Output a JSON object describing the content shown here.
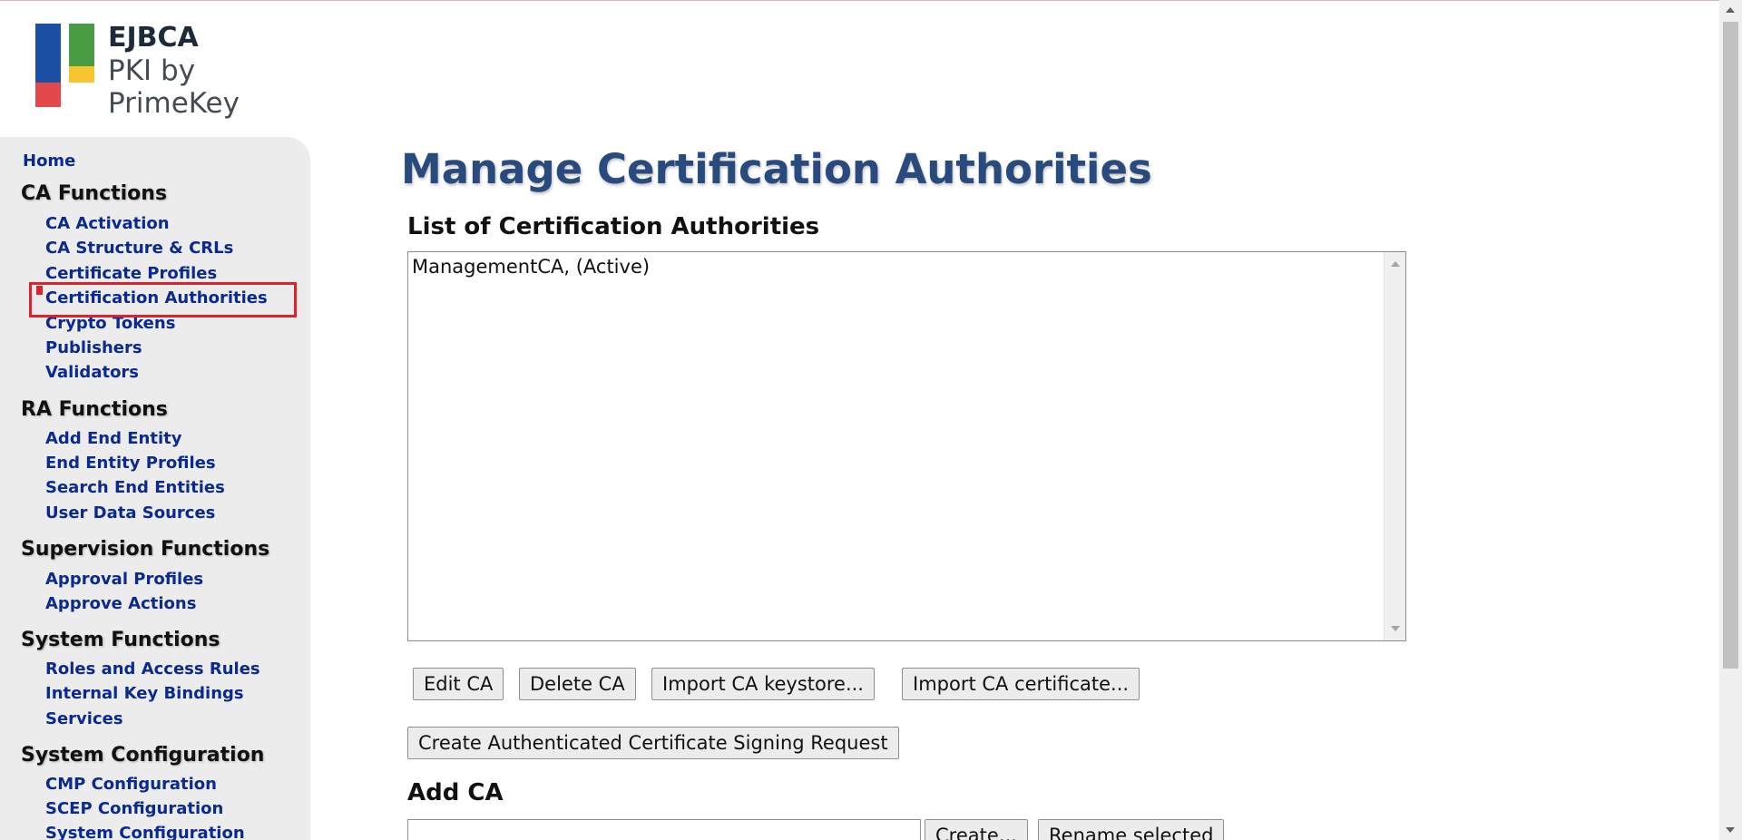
{
  "logo": {
    "title": "EJBCA",
    "subtitle": "PKI by PrimeKey"
  },
  "sidebar": {
    "home": "Home",
    "sections": [
      {
        "title": "CA Functions",
        "items": [
          "CA Activation",
          "CA Structure & CRLs",
          "Certificate Profiles",
          "Certification Authorities",
          "Crypto Tokens",
          "Publishers",
          "Validators"
        ]
      },
      {
        "title": "RA Functions",
        "items": [
          "Add End Entity",
          "End Entity Profiles",
          "Search End Entities",
          "User Data Sources"
        ]
      },
      {
        "title": "Supervision Functions",
        "items": [
          "Approval Profiles",
          "Approve Actions"
        ]
      },
      {
        "title": "System Functions",
        "items": [
          "Roles and Access Rules",
          "Internal Key Bindings",
          "Services"
        ]
      },
      {
        "title": "System Configuration",
        "items": [
          "CMP Configuration",
          "SCEP Configuration",
          "System Configuration"
        ]
      }
    ],
    "highlighted_item": "Certification Authorities"
  },
  "main": {
    "page_title": "Manage Certification Authorities",
    "list_heading": "List of Certification Authorities",
    "ca_list": [
      "ManagementCA, (Active)"
    ],
    "buttons": {
      "edit_ca": "Edit CA",
      "delete_ca": "Delete CA",
      "import_keystore": "Import CA keystore...",
      "import_certificate": "Import CA certificate...",
      "create_csr": "Create Authenticated Certificate Signing Request"
    },
    "add_ca": {
      "heading": "Add CA",
      "input_value": "",
      "create_label": "Create...",
      "rename_label": "Rename selected"
    }
  },
  "colors": {
    "link": "#0b2a8f",
    "title": "#284a7d",
    "sidebar_bg": "#ececec",
    "highlight": "#e0212b"
  }
}
